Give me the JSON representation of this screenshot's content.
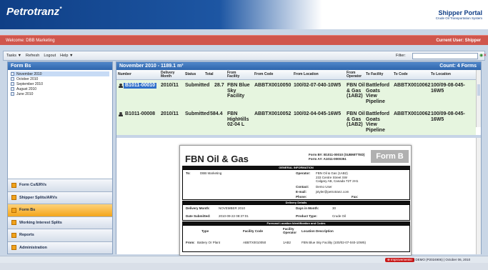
{
  "header": {
    "logo": "Petrotranz",
    "logo_mark": "*",
    "portal_title": "Shipper Portal",
    "portal_subtitle": "Crude Oil Transportation System"
  },
  "welcome": {
    "text": "Welcome: DBB Marketing",
    "current_user": "Current User: Shipper"
  },
  "toolbar": {
    "items": [
      {
        "label": "Tasks",
        "caret": "▼"
      },
      {
        "label": "Refresh"
      },
      {
        "label": "Logout"
      },
      {
        "label": "Help",
        "caret": "▼"
      }
    ],
    "filter_label": "Filter:"
  },
  "left": {
    "title": "Form Bs",
    "months": [
      "November 2010",
      "October 2010",
      "September 2010",
      "August 2010",
      "June 2010"
    ],
    "nav": [
      "Form Cs/ERVs",
      "Shipper Splits/ARVs",
      "Form Bs",
      "Working Interest Splits",
      "Reports",
      "Administration"
    ]
  },
  "grid": {
    "title": "November 2010 - 1189.1 m³",
    "count": "Count: 4 Forms",
    "columns": [
      "Number",
      "Delivery Month",
      "Status",
      "Total",
      "From Facility",
      "From Code",
      "From Location",
      "From Operator",
      "To Facility",
      "To Code",
      "To Location"
    ],
    "rows": [
      {
        "number": "B1011-00010",
        "month": "2010/11",
        "status": "Submitted",
        "total": "28.7",
        "from_facility": "FBN Blue Sky Facility",
        "from_code": "ABBTX0010050",
        "from_location": "100/02-07-040-10W5",
        "from_operator": "FBN Oil & Gas (1AB2)",
        "to_facility": "Battleford Goats View Pipeline",
        "to_code": "ABBTX0010062",
        "to_location": "100/09-08-045-16W5"
      },
      {
        "number": "B1011-00008",
        "month": "2010/11",
        "status": "Submitted",
        "total": "584.4",
        "from_facility": "FBN HighHills 02-04 L",
        "from_code": "ABBTX0010052",
        "from_location": "100/02-04-045-16W5",
        "from_operator": "FBN Oil & Gas (1AB2)",
        "to_facility": "Battleford Goats View Pipeline",
        "to_code": "ABBTX0010062",
        "to_location": "100/09-08-045-16W5"
      }
    ]
  },
  "doc": {
    "company": "FBN Oil & Gas",
    "form_num": "Form B#: B1011-00010 (SUBMITTED)",
    "form_a": "Form A#: A1011-0000351",
    "badge": "Form B",
    "gen_info": "GENERAL INFORMATION",
    "to_label": "To:",
    "to_val": "DBB Marketing",
    "op_label": "Operator:",
    "op_val": "FBN Oil & Gas (1AB2)",
    "addr1": "233 Centre Street SW",
    "addr2": "Calgary AB, Canada T2T 2H1",
    "contact_label": "Contact:",
    "contact_val": "Demo User",
    "email_label": "E-mail:",
    "email_val": "jstyler@petrotranz.com",
    "phone_label": "Phone:",
    "fax_label": "Fax:",
    "delivery": "Delivery Details",
    "dm_label": "Delivery Month:",
    "dm_val": "NOVEMBER 2010",
    "dim_label": "Days in Month:",
    "dim_val": "30",
    "ds_label": "Date Submitted:",
    "ds_val": "2010-09-22 08:37:01",
    "pt_label": "Product Type:",
    "pt_val": "Crude Oil",
    "forecast": "Forecast Location Identification and Codes",
    "type_h": "Type",
    "fc_h": "Facility Code",
    "fo_h": "Facility Operator",
    "ld_h": "Location Description",
    "from_label": "From:",
    "from_type": "Battery Or Plant",
    "from_code": "ABBTX0010050",
    "from_op": "1AB2",
    "from_desc": "FBN Blue Sky Facility (100/02-07-040-10W5)"
  },
  "footer": {
    "improve": "⊕ Improvements!",
    "build": "| DEMO (P2024906) | October 06, 2010"
  }
}
